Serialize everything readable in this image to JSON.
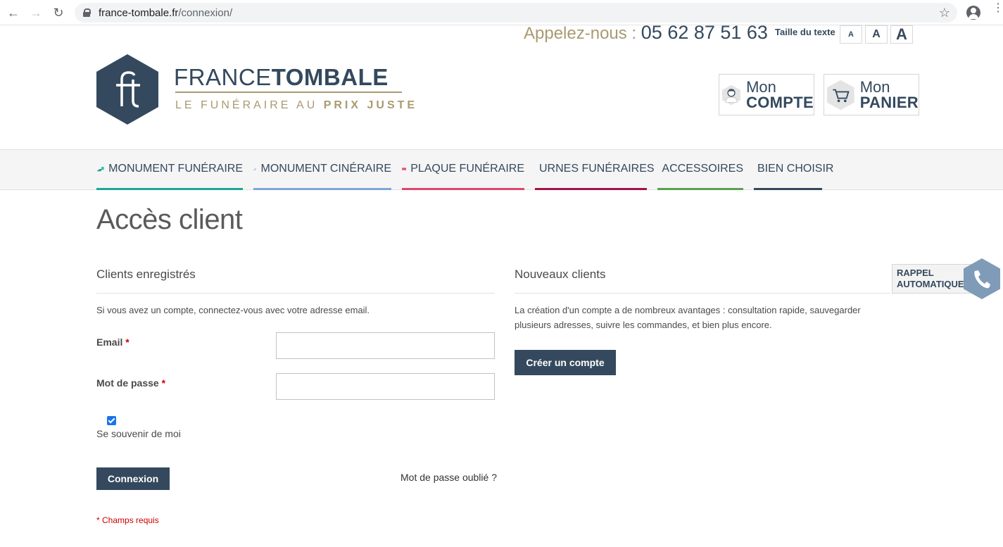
{
  "browser": {
    "url_domain": "france-tombale.fr",
    "url_path": "/connexion/"
  },
  "header": {
    "phone_label": "Appelez-nous : ",
    "phone_number": "05 62 87 51 63",
    "text_size_label": "Taille du texte",
    "text_size_buttons": [
      "A",
      "A",
      "A"
    ],
    "logo": {
      "name_light": "FRANCE",
      "name_bold": "TOMBALE",
      "tagline_light": "LE FUNÉRAIRE AU ",
      "tagline_bold": "PRIX JUSTE"
    },
    "account": {
      "line1": "Mon",
      "line2": "COMPTE"
    },
    "cart": {
      "line1": "Mon",
      "line2": "PANIER"
    }
  },
  "nav": {
    "items": [
      {
        "label": "MONUMENT FUNÉRAIRE",
        "color": "#1aa695"
      },
      {
        "label": "MONUMENT CINÉRAIRE",
        "color": "#7fa4d8"
      },
      {
        "label": "PLAQUE FUNÉRAIRE",
        "color": "#e0466a"
      },
      {
        "label": "URNES FUNÉRAIRES",
        "color": "#a3124a"
      },
      {
        "label": "ACCESSOIRES",
        "color": "#5aa14f"
      },
      {
        "label": "BIEN CHOISIR",
        "color": "#34495e"
      }
    ]
  },
  "main": {
    "title": "Accès client",
    "registered": {
      "title": "Clients enregistrés",
      "description": "Si vous avez un compte, connectez-vous avec votre adresse email.",
      "email_label": "Email",
      "email_value": "",
      "password_label": "Mot de passe",
      "password_value": "",
      "required_mark": "*",
      "remember_label": "Se souvenir de moi",
      "remember_checked": true,
      "login_button": "Connexion",
      "forgot_link": "Mot de passe oublié ?",
      "required_note": "* Champs requis"
    },
    "new_clients": {
      "title": "Nouveaux clients",
      "description_line1": "La création d'un compte a de nombreux avantages : consultation rapide, sauvegarder",
      "description_line2": "plusieurs adresses, suivre les commandes, et bien plus encore.",
      "create_button": "Créer un compte"
    }
  },
  "rappel": {
    "line1": "RAPPEL",
    "line2": "AUTOMATIQUE"
  },
  "colors": {
    "brand_blue": "#34495e",
    "brand_gold": "#a99a6f",
    "required_red": "#cc0000"
  }
}
